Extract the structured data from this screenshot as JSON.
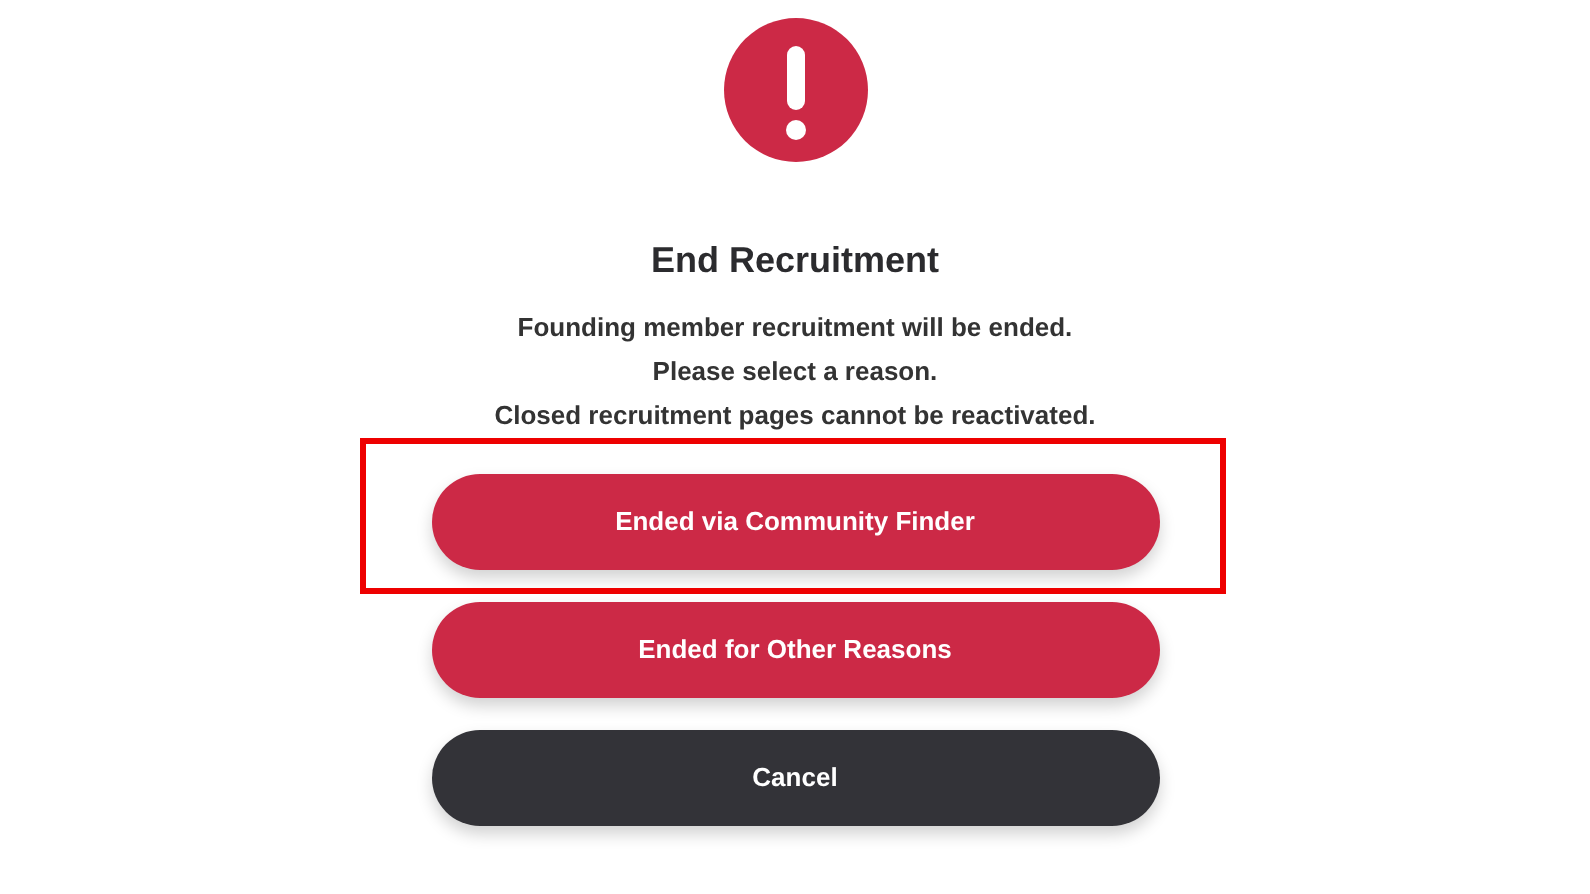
{
  "dialog": {
    "title": "End Recruitment",
    "message_lines": [
      "Founding member recruitment will be ended.",
      "Please select a reason.",
      "Closed recruitment pages cannot be reactivated."
    ]
  },
  "buttons": [
    {
      "label": "Ended via Community Finder",
      "kind": "danger",
      "highlighted": true
    },
    {
      "label": "Ended for Other Reasons",
      "kind": "danger",
      "highlighted": false
    },
    {
      "label": "Cancel",
      "kind": "neutral",
      "highlighted": false
    }
  ]
}
